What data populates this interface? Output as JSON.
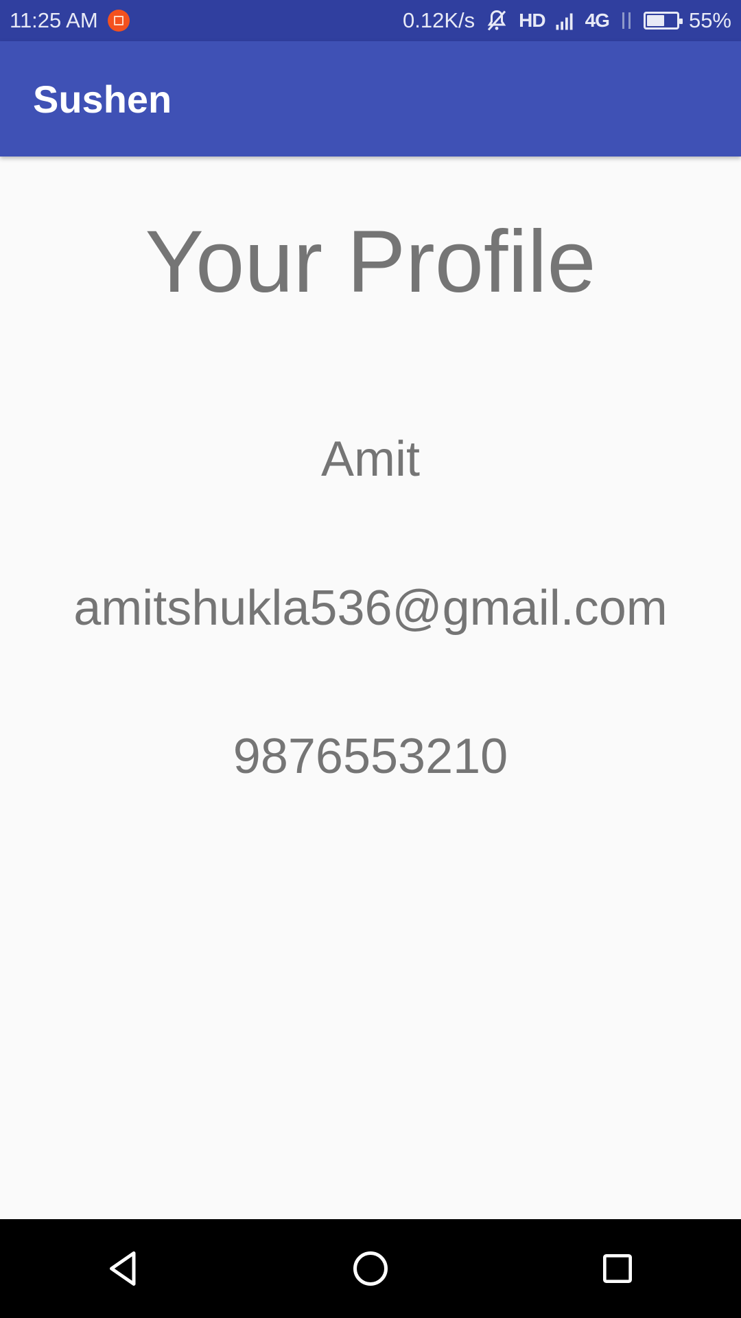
{
  "status_bar": {
    "time": "11:25 AM",
    "net_speed": "0.12K/s",
    "hd": "HD",
    "network": "4G",
    "battery_level": 0.55,
    "battery": "55%",
    "icons": [
      "orange-notification-icon",
      "mute-bell-icon",
      "signal-icon",
      "data-arrows-icon",
      "battery-icon"
    ]
  },
  "app_bar": {
    "title": "Sushen",
    "color": "#3f51b5"
  },
  "profile": {
    "heading": "Your Profile",
    "name": "Amit",
    "email": "amitshukla536@gmail.com",
    "phone": "9876553210"
  },
  "nav": {
    "buttons": [
      "back-icon",
      "home-icon",
      "recents-icon"
    ]
  },
  "colors": {
    "status_bar": "#303f9f",
    "primary": "#3f51b5",
    "text_gray": "#757575",
    "background": "#fafafa"
  }
}
